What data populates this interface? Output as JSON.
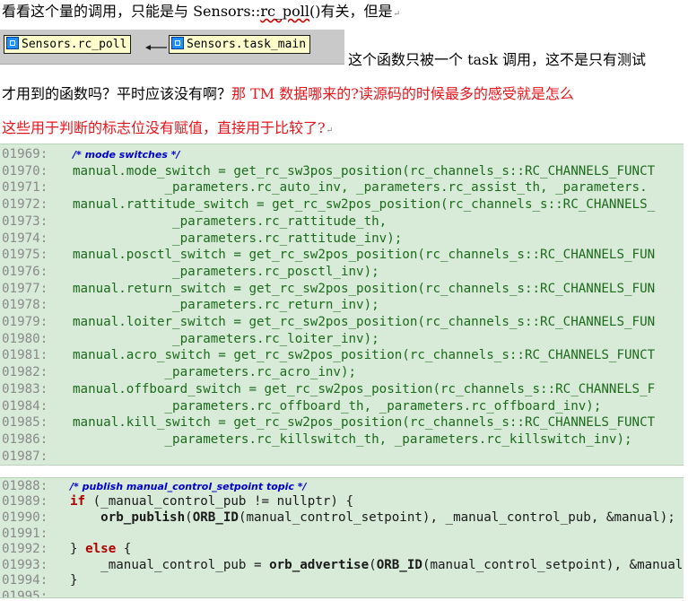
{
  "para1": {
    "prefix": "看看这个量的调用，只能是与 Sensors::",
    "func": "rc_poll",
    "suffix": "()有关，但是"
  },
  "graph": {
    "callee": "Sensors.rc_poll",
    "caller": "Sensors.task_main"
  },
  "para2": {
    "line1": "这个函数只被一个 task 调用，这不是只有测试",
    "line2_black": "才用到的函数吗？平时应该没有啊？",
    "line2_red": "那 TM 数据哪来的?读源码的时候最多的感受就是怎么",
    "line3_red": "这些用于判断的标志位没有赋值，直接用于比较了?"
  },
  "code1": {
    "lines": [
      {
        "num": "01969:",
        "text": "/* mode switches */",
        "kind": "comment"
      },
      {
        "num": "01970:",
        "text": "manual.mode_switch = get_rc_sw3pos_position(rc_channels_s::RC_CHANNELS_FUNCT",
        "kind": "code"
      },
      {
        "num": "01971:",
        "text": "            _parameters.rc_auto_inv, _parameters.rc_assist_th, _parameters.",
        "kind": "code"
      },
      {
        "num": "01972:",
        "text": "manual.rattitude_switch = get_rc_sw2pos_position(rc_channels_s::RC_CHANNELS_",
        "kind": "code"
      },
      {
        "num": "01973:",
        "text": "             _parameters.rc_rattitude_th,",
        "kind": "code"
      },
      {
        "num": "01974:",
        "text": "             _parameters.rc_rattitude_inv);",
        "kind": "code"
      },
      {
        "num": "01975:",
        "text": "manual.posctl_switch = get_rc_sw2pos_position(rc_channels_s::RC_CHANNELS_FUN",
        "kind": "code"
      },
      {
        "num": "01976:",
        "text": "             _parameters.rc_posctl_inv);",
        "kind": "code"
      },
      {
        "num": "01977:",
        "text": "manual.return_switch = get_rc_sw2pos_position(rc_channels_s::RC_CHANNELS_FUN",
        "kind": "code"
      },
      {
        "num": "01978:",
        "text": "             _parameters.rc_return_inv);",
        "kind": "code"
      },
      {
        "num": "01979:",
        "text": "manual.loiter_switch = get_rc_sw2pos_position(rc_channels_s::RC_CHANNELS_FUN",
        "kind": "code"
      },
      {
        "num": "01980:",
        "text": "             _parameters.rc_loiter_inv);",
        "kind": "code"
      },
      {
        "num": "01981:",
        "text": "manual.acro_switch = get_rc_sw2pos_position(rc_channels_s::RC_CHANNELS_FUNCT",
        "kind": "code"
      },
      {
        "num": "01982:",
        "text": "            _parameters.rc_acro_inv);",
        "kind": "code"
      },
      {
        "num": "01983:",
        "text": "manual.offboard_switch = get_rc_sw2pos_position(rc_channels_s::RC_CHANNELS_F",
        "kind": "code"
      },
      {
        "num": "01984:",
        "text": "            _parameters.rc_offboard_th, _parameters.rc_offboard_inv);",
        "kind": "code"
      },
      {
        "num": "01985:",
        "text": "manual.kill_switch = get_rc_sw2pos_position(rc_channels_s::RC_CHANNELS_FUNCT",
        "kind": "code"
      },
      {
        "num": "01986:",
        "text": "            _parameters.rc_killswitch_th, _parameters.rc_killswitch_inv);",
        "kind": "code"
      },
      {
        "num": "01987:",
        "text": "",
        "kind": "code"
      }
    ]
  },
  "code2": {
    "l1988": {
      "num": "01988:",
      "comment": "/* publish manual_control_setpoint topic */"
    },
    "l1989": {
      "num": "01989:",
      "kw": "if",
      "rest": " (_manual_control_pub != nullptr) {"
    },
    "l1990": {
      "num": "01990:",
      "indent": "    ",
      "fn": "orb_publish",
      "p1": "(",
      "macro": "ORB_ID",
      "rest": "(manual_control_setpoint), _manual_control_pub, &manual);"
    },
    "l1991": {
      "num": "01991:"
    },
    "l1992": {
      "num": "01992:",
      "pre": "} ",
      "kw": "else",
      "rest": " {"
    },
    "l1993": {
      "num": "01993:",
      "indent": "    ",
      "lhs": "_manual_control_pub = ",
      "fn": "orb_advertise",
      "p1": "(",
      "macro": "ORB_ID",
      "rest": "(manual_control_setpoint), &manual);"
    },
    "l1994": {
      "num": "01994:",
      "text": "}"
    },
    "l1995": {
      "num": "01995:"
    }
  },
  "colors": {
    "red_text": "#e8141b",
    "code_bg": "#d8ead8",
    "node_bg": "#ffffcc"
  }
}
